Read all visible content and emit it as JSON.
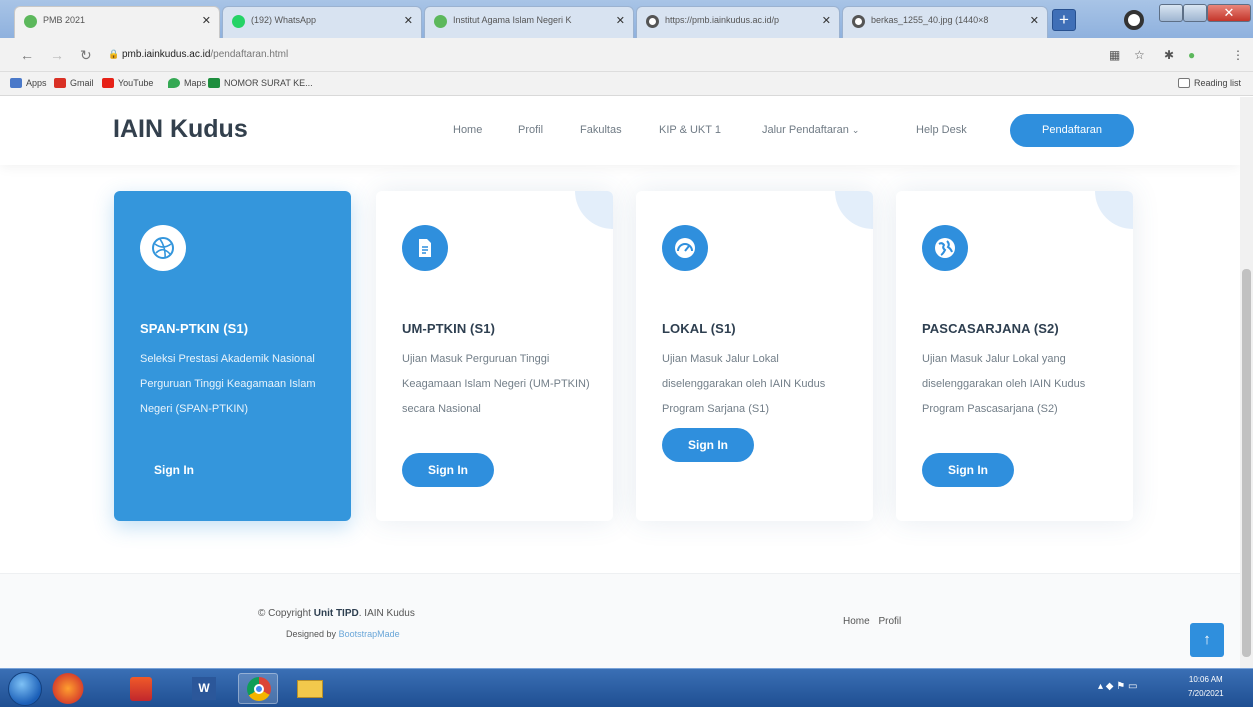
{
  "browser": {
    "tabs": [
      {
        "label": "PMB 2021"
      },
      {
        "label": "(192) WhatsApp"
      },
      {
        "label": "Institut Agama Islam Negeri K"
      },
      {
        "label": "https://pmb.iainkudus.ac.id/p"
      },
      {
        "label": "berkas_1255_40.jpg (1440×8"
      }
    ],
    "url_host": "pmb.iainkudus.ac.id",
    "url_path": "/pendaftaran.html",
    "reading_list": "Reading list",
    "bookmarks": [
      {
        "label": "Apps",
        "icon": "apps-grid-icon",
        "color": "#4a79c9"
      },
      {
        "label": "Gmail",
        "icon": "gmail-icon",
        "color": "#d93025"
      },
      {
        "label": "YouTube",
        "icon": "youtube-icon",
        "color": "#e62117"
      },
      {
        "label": "Maps",
        "icon": "maps-pin-icon",
        "color": "#34a853"
      },
      {
        "label": "NOMOR SURAT KE...",
        "icon": "sheets-icon",
        "color": "#1e8e3e"
      }
    ]
  },
  "site": {
    "logo": "IAIN Kudus",
    "nav": {
      "home": "Home",
      "profil": "Profil",
      "fakultas": "Fakultas",
      "kip": "KIP & UKT 1",
      "jalur": "Jalur Pendaftaran",
      "helpdesk": "Help Desk"
    },
    "cta": "Pendaftaran",
    "accent_color": "#2f8fdd",
    "cards": [
      {
        "title": "SPAN-PTKIN (S1)",
        "description": "Seleksi Prestasi Akademik Nasional Perguruan Tinggi Keagamaan Islam Negeri (SPAN-PTKIN)",
        "button": "Sign In",
        "icon": "dribbble-ball-icon"
      },
      {
        "title": "UM-PTKIN (S1)",
        "description": "Ujian Masuk Perguruan Tinggi Keagamaan Islam Negeri (UM-PTKIN) secara Nasional",
        "button": "Sign In",
        "icon": "document-icon"
      },
      {
        "title": "LOKAL (S1)",
        "description": "Ujian Masuk Jalur Lokal diselenggarakan oleh IAIN Kudus Program Sarjana (S1)",
        "button": "Sign In",
        "icon": "speedometer-icon"
      },
      {
        "title": "PASCASARJANA (S2)",
        "description": "Ujian Masuk Jalur Lokal yang diselenggarakan oleh IAIN Kudus Program Pascasarjana (S2)",
        "button": "Sign In",
        "icon": "globe-icon"
      }
    ],
    "footer": {
      "copyright_prefix": "© Copyright",
      "copyright_org": "Unit TIPD",
      "copyright_suffix": ". IAIN Kudus",
      "designed_prefix": "Designed by",
      "designed_by": "BootstrapMade",
      "links": {
        "home": "Home",
        "profil": "Profil"
      }
    }
  },
  "taskbar": {
    "clock_time": "10:06 AM",
    "clock_date": "7/20/2021"
  }
}
